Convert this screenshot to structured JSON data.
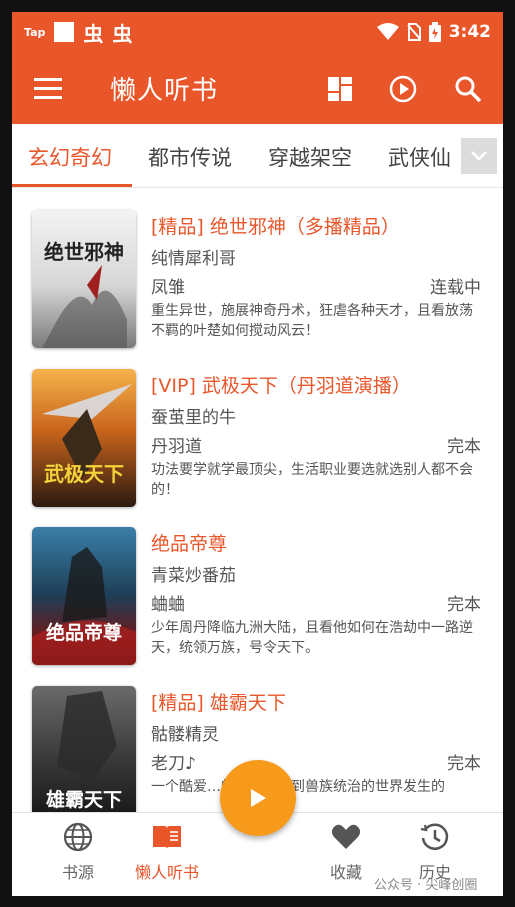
{
  "status_bar": {
    "tap": "Tap",
    "chong1": "虫",
    "chong2": "虫",
    "time": "3:42"
  },
  "app_bar": {
    "title": "懒人听书"
  },
  "tabs": [
    {
      "label": "玄幻奇幻",
      "active": true
    },
    {
      "label": "都市传说",
      "active": false
    },
    {
      "label": "穿越架空",
      "active": false
    },
    {
      "label": "武侠仙",
      "active": false
    }
  ],
  "books": [
    {
      "title": "[精品] 绝世邪神（多播精品）",
      "author": "纯情犀利哥",
      "narrator": "凤雏",
      "status": "连载中",
      "description": "重生异世，施展神奇丹术，狂虐各种天才，且看放荡不羁的叶楚如何搅动风云！",
      "cover_text": "绝世邪神"
    },
    {
      "title": "[VIP] 武极天下（丹羽道演播）",
      "author": "蚕茧里的牛",
      "narrator": "丹羽道",
      "status": "完本",
      "description": "功法要学就学最顶尖，生活职业要选就选别人都不会的！",
      "cover_text": "武极天下"
    },
    {
      "title": "绝品帝尊",
      "author": "青菜炒番茄",
      "narrator": "蛐蛐",
      "status": "完本",
      "description": "少年周丹降临九洲大陆，且看他如何在浩劫中一路逆天，统领万族，号令天下。",
      "cover_text": "绝品帝尊"
    },
    {
      "title": "[精品] 雄霸天下",
      "author": "骷髅精灵",
      "narrator": "老刀♪",
      "status": "完本",
      "description": "一个酷爱…的宅男穿越到兽族统治的世界发生的",
      "cover_text": "雄霸天下"
    }
  ],
  "bottom_nav": [
    {
      "label": "书源",
      "icon": "globe-icon",
      "active": false
    },
    {
      "label": "懒人听书",
      "icon": "book-icon",
      "active": true
    },
    {
      "label": "收藏",
      "icon": "heart-icon",
      "active": false
    },
    {
      "label": "历史",
      "icon": "history-icon",
      "active": false
    }
  ],
  "watermark": "公众号 · 尖峰创圈",
  "colors": {
    "primary": "#e8562a",
    "fab": "#f79a1c"
  }
}
